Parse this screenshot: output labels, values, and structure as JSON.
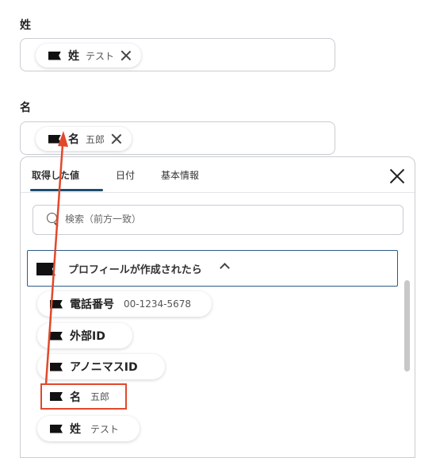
{
  "fields": [
    {
      "label": "姓",
      "chip": {
        "label": "姓",
        "value": "テスト"
      }
    },
    {
      "label": "名",
      "chip": {
        "label": "名",
        "value": "五郎"
      }
    }
  ],
  "panel": {
    "tabs": [
      {
        "label": "取得した値",
        "active": true
      },
      {
        "label": "日付",
        "active": false
      },
      {
        "label": "基本情報",
        "active": false
      }
    ],
    "search": {
      "placeholder": "検索（前方一致）",
      "value": ""
    },
    "section": {
      "title": "プロフィールが作成されたら",
      "expanded": true
    },
    "items": [
      {
        "label": "電話番号",
        "value": "00-1234-5678"
      },
      {
        "label": "外部ID",
        "value": ""
      },
      {
        "label": "アノニマスID",
        "value": ""
      },
      {
        "label": "名",
        "value": "五郎",
        "highlighted": true
      },
      {
        "label": "姓",
        "value": "テスト"
      }
    ]
  },
  "colors": {
    "annotation": "#e2482a",
    "section_border": "#2d5a88",
    "tab_underline": "#1f4e6e"
  },
  "icons": {
    "chip": "flag-icon",
    "remove": "close-icon",
    "search": "search-icon",
    "collapse": "chevron-up-icon"
  }
}
